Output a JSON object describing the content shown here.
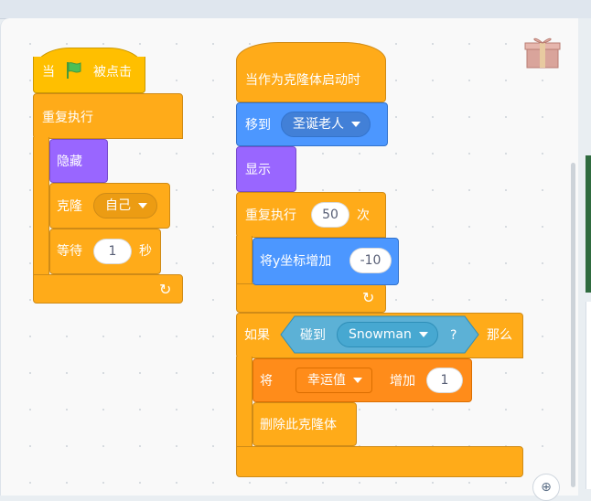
{
  "script1": {
    "hat_pre": "当",
    "hat_post": "被点击",
    "forever": "重复执行",
    "hide": "隐藏",
    "clone_label": "克隆",
    "clone_target": "自己",
    "wait_label": "等待",
    "wait_value": "1",
    "wait_unit": "秒"
  },
  "script2": {
    "hat": "当作为克隆体启动时",
    "goto_label": "移到",
    "goto_target": "圣诞老人",
    "show": "显示",
    "repeat_label": "重复执行",
    "repeat_value": "50",
    "repeat_unit": "次",
    "change_y_label": "将y坐标增加",
    "change_y_value": "-10",
    "if_label": "如果",
    "touching_label": "碰到",
    "touching_target": "Snowman",
    "touching_q": "?",
    "then_label": "那么",
    "change_var_pre": "将",
    "change_var_name": "幸运值",
    "change_var_mid": "增加",
    "change_var_value": "1",
    "delete_clone": "删除此克隆体"
  },
  "colors": {
    "control": "#ffab19",
    "looks": "#9966ff",
    "motion": "#4c97ff",
    "events": "#ffbf00",
    "sensing": "#5cb1d6",
    "variables": "#ff8c1a"
  },
  "icons": {
    "flag": "green-flag-icon",
    "gift": "gift-icon",
    "loop": "loop-arrow-icon",
    "zoom": "zoom-in-icon"
  }
}
